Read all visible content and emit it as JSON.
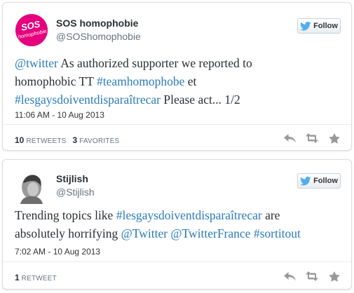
{
  "tweets": [
    {
      "user": {
        "name": "SOS homophobie",
        "handle": "@SOShomophobie",
        "avatar_text": "SOS homophobie"
      },
      "follow_label": "Follow",
      "text_segments": [
        [
          {
            "t": "@twitter",
            "link": true
          },
          {
            "t": " As authorized supporter we reported to",
            "link": false
          }
        ],
        [
          {
            "t": "homophobic TT ",
            "link": false
          },
          {
            "t": "#teamhomophobe",
            "link": true
          },
          {
            "t": " et",
            "link": false
          }
        ],
        [
          {
            "t": " #lesgaysdoiventdisparaîtrecar",
            "link": true
          },
          {
            "t": " Please act... 1/2",
            "link": false
          }
        ]
      ],
      "timestamp": "11:06 AM - 10 Aug 2013",
      "stats": [
        {
          "count": "10",
          "label": "RETWEETS"
        },
        {
          "count": "3",
          "label": "FAVORITES"
        }
      ]
    },
    {
      "user": {
        "name": "Stijlish",
        "handle": "@Stijlish"
      },
      "follow_label": "Follow",
      "text_segments": [
        [
          {
            "t": "Trending topics like ",
            "link": false
          },
          {
            "t": "#lesgaysdoiventdisparaîtrecar",
            "link": true
          },
          {
            "t": " are",
            "link": false
          }
        ],
        [
          {
            "t": "absolutely horrifying ",
            "link": false
          },
          {
            "t": "@Twitter",
            "link": true
          },
          {
            "t": " ",
            "link": false
          },
          {
            "t": "@TwitterFrance",
            "link": true
          },
          {
            "t": " ",
            "link": false
          },
          {
            "t": "#sortitout",
            "link": true
          }
        ]
      ],
      "timestamp": "7:02 AM - 10 Aug 2013",
      "stats": [
        {
          "count": "1",
          "label": "RETWEET"
        }
      ]
    }
  ],
  "icons": {
    "follow": "twitter-bird-icon",
    "reply": "reply-icon",
    "retweet": "retweet-icon",
    "favorite": "star-icon"
  },
  "colors": {
    "link": "#2b7bb9",
    "bird": "#55acee",
    "avatar_brand": "#e5007d",
    "action_icon": "#999999"
  }
}
